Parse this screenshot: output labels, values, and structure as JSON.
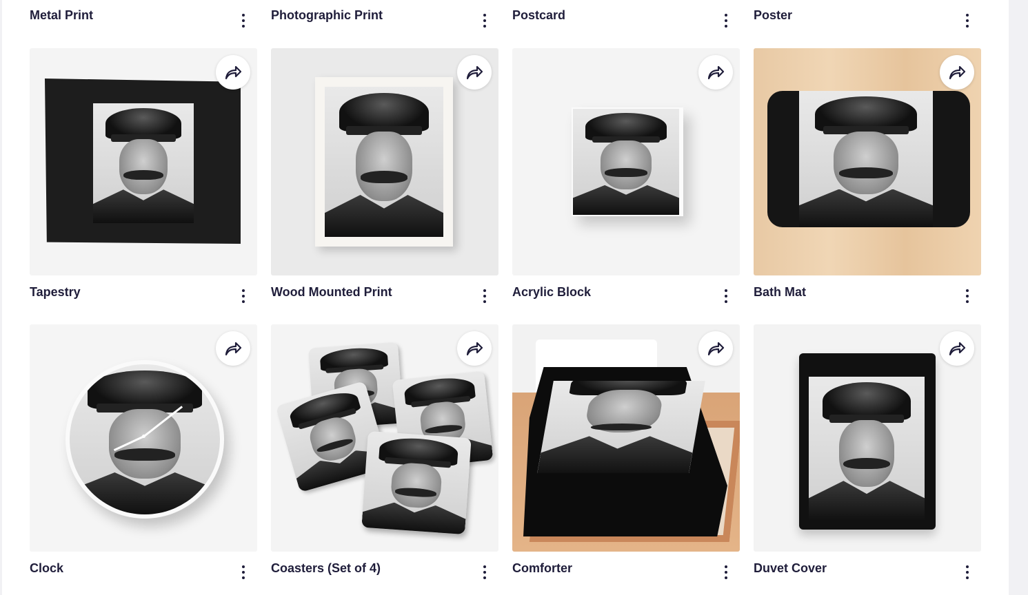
{
  "products": [
    {
      "title": "Metal Print"
    },
    {
      "title": "Photographic Print"
    },
    {
      "title": "Postcard"
    },
    {
      "title": "Poster"
    },
    {
      "title": "Tapestry"
    },
    {
      "title": "Wood Mounted Print"
    },
    {
      "title": "Acrylic Block"
    },
    {
      "title": "Bath Mat"
    },
    {
      "title": "Clock"
    },
    {
      "title": "Coasters (Set of 4)"
    },
    {
      "title": "Comforter"
    },
    {
      "title": "Duvet Cover"
    }
  ],
  "icons": {
    "share": "share-arrow-icon",
    "more": "more-vertical-icon"
  },
  "colors": {
    "text": "#1f1d3a",
    "thumb_bg": "#f3f3f3",
    "share_bg": "#ffffff"
  }
}
